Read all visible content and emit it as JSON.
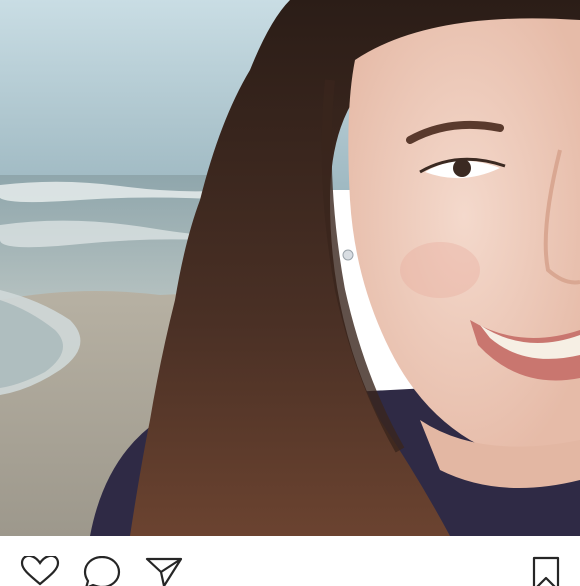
{
  "post": {
    "photo": {
      "description_icon": "selfie-photo"
    },
    "actions": {
      "like_icon": "heart-icon",
      "comment_icon": "comment-icon",
      "share_icon": "send-icon",
      "save_icon": "bookmark-icon"
    }
  },
  "colors": {
    "icon_stroke": "#262626",
    "background": "#ffffff"
  }
}
